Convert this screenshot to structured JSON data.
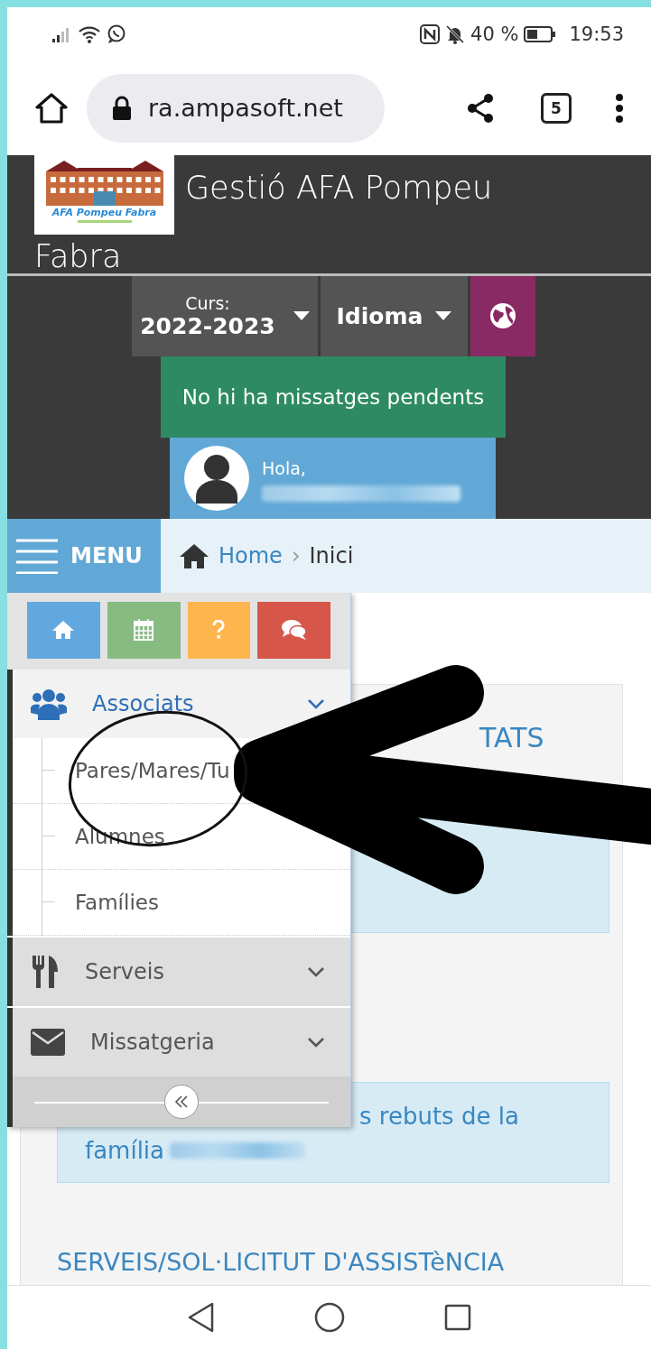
{
  "status_bar": {
    "battery": "40 %",
    "time": "19:53"
  },
  "browser": {
    "url": "ra.ampasoft.net",
    "tab_count": "5"
  },
  "header": {
    "logo": {
      "text": "AFA Pompeu Fabra"
    },
    "title_lines": [
      "Gestió AFA Pompeu",
      "Fabra"
    ],
    "course": {
      "label": "Curs:",
      "value": "2022-2023"
    },
    "language": {
      "label": "Idioma"
    },
    "message": "No hi ha missatges pendents",
    "user": {
      "greeting": "Hola,"
    }
  },
  "breadcrumb": {
    "menu": "MENU",
    "items": [
      {
        "label": "Home",
        "link": true
      },
      {
        "label": "Inici",
        "link": false
      }
    ],
    "separator": "›"
  },
  "content": {
    "heading_fragment": "TATS",
    "box2_line1": "s rebuts de la",
    "box2_line2": "família",
    "heading2": "SERVEIS/SOL·LICITUT D'ASSISTèNCIA"
  },
  "menu": {
    "quick": [
      {
        "kind": "home",
        "color": "#62a8e0"
      },
      {
        "kind": "calendar",
        "color": "#87bb82"
      },
      {
        "kind": "help",
        "color": "#ffb54d"
      },
      {
        "kind": "chat",
        "color": "#d6574a"
      }
    ],
    "sections": [
      {
        "label": "Associats",
        "kind": "people",
        "expanded": true,
        "children": [
          {
            "label": "Pares/Mares/Tu"
          },
          {
            "label": "Alumnes"
          },
          {
            "label": "Famílies"
          }
        ]
      },
      {
        "label": "Serveis",
        "kind": "cutlery",
        "expanded": false
      },
      {
        "label": "Missatgeria",
        "kind": "envelope",
        "expanded": false
      }
    ]
  }
}
